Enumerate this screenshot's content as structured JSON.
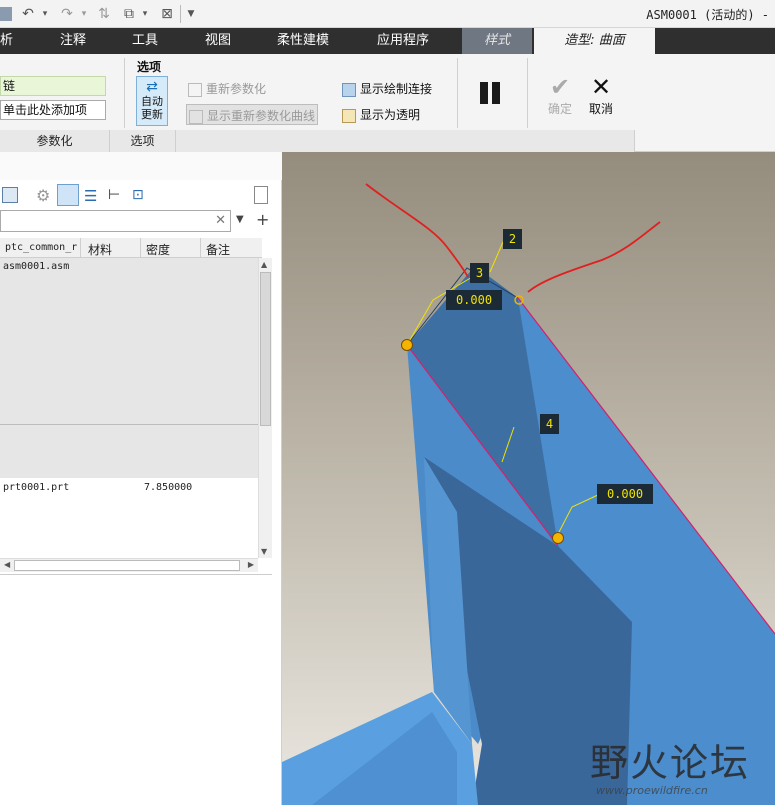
{
  "window": {
    "title": "ASM0001 (活动的) -"
  },
  "tabs": [
    {
      "label": "析"
    },
    {
      "label": "注释"
    },
    {
      "label": "工具"
    },
    {
      "label": "视图"
    },
    {
      "label": "柔性建模"
    },
    {
      "label": "应用程序"
    },
    {
      "label": "样式"
    },
    {
      "label": "造型: 曲面"
    }
  ],
  "ribbon": {
    "chain_field": "链",
    "add_item_field": "单击此处添加项",
    "options_title": "选项",
    "auto_update": "自动\n更新",
    "reparametrize": "重新参数化",
    "show_reparam_curves": "显示重新参数化曲线",
    "show_draw_connection": "显示绘制连接",
    "show_transparent": "显示为透明",
    "ok": "确定",
    "cancel": "取消",
    "group_param": "参数化",
    "group_options": "选项"
  },
  "model_tree": {
    "columns": [
      "ptc_common_r",
      "材料",
      "密度",
      "备注"
    ],
    "rows": [
      {
        "name": "asm0001.asm",
        "density": ""
      },
      {
        "name": "prt0001.prt",
        "density": "7.850000"
      }
    ]
  },
  "viewport": {
    "labels": [
      "2",
      "3",
      "4"
    ],
    "values": [
      "0.000",
      "0.000"
    ]
  },
  "watermark": {
    "title": "野火论坛",
    "url": "www.proewildfire.cn"
  },
  "colors": {
    "surface": "#4a8ccc",
    "tab_active": "#f4f4f4",
    "tag_bg": "#1c2a35",
    "tag_fg": "#f0e300",
    "curve": "#e02020"
  }
}
